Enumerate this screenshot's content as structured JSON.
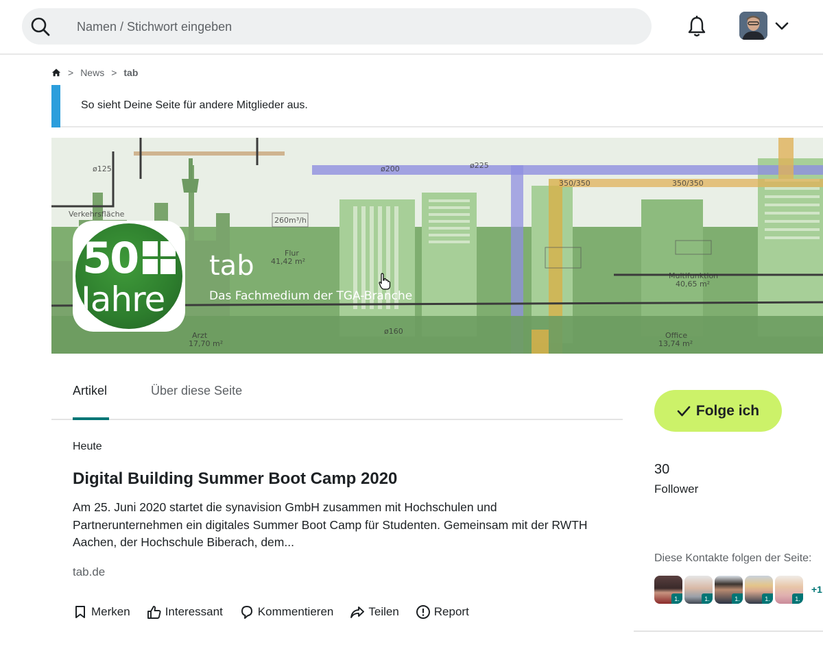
{
  "search": {
    "placeholder": "Namen / Stichwort eingeben"
  },
  "breadcrumb": {
    "items": [
      "News",
      "tab"
    ]
  },
  "info_banner": {
    "text": "So sieht Deine Seite für andere Mitglieder aus."
  },
  "page": {
    "logo_text_top": "50",
    "logo_text_bottom": "Jahre",
    "name": "tab",
    "tagline": "Das Fachmedium der TGA-Branche"
  },
  "tabs": [
    {
      "label": "Artikel",
      "active": true
    },
    {
      "label": "Über diese Seite",
      "active": false
    }
  ],
  "article": {
    "date": "Heute",
    "title": "Digital Building Summer Boot Camp 2020",
    "body": "Am 25. Juni 2020 startet die synavision GmbH zusammen mit Hochschulen und Partnerunternehmen ein digitales Summer Boot Camp für Studenten. Gemeinsam mit der RWTH Aachen, der Hochschule Biberach, dem...",
    "source": "tab.de",
    "actions": [
      "Merken",
      "Interessant",
      "Kommentieren",
      "Teilen",
      "Report"
    ]
  },
  "sidebar": {
    "follow_label": "Folge ich",
    "follower_count": "30",
    "follower_label": "Follower",
    "contacts_label": "Diese Kontakte folgen der Seite:",
    "contact_degree": "1.",
    "more_count": "+1"
  },
  "colors": {
    "accent": "#007575",
    "follow_button": "#ccf269",
    "info_bar": "#2c9edc"
  }
}
